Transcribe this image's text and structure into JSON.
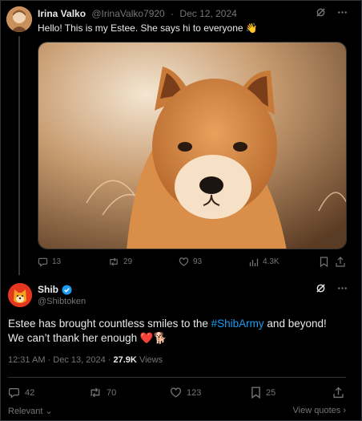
{
  "reply": {
    "display_name": "Irina Valko",
    "handle": "@IrinaValko7920",
    "separator": "·",
    "date": "Dec 12, 2024",
    "text": "Hello! This is my Estee. She says hi to everyone 👋",
    "image_alt": "Shiba Inu dog portrait",
    "stats": {
      "replies": "13",
      "reposts": "29",
      "likes": "93",
      "views": "4.3K"
    }
  },
  "main": {
    "display_name": "Shib",
    "handle": "@Shibtoken",
    "text_before": "Estee has brought countless smiles to the ",
    "hashtag": "#ShibArmy",
    "text_after": " and beyond! We can’t thank her enough ❤️🐕",
    "time": "12:31 AM",
    "separator": "·",
    "date": "Dec 13, 2024",
    "views_count": "27.9K",
    "views_label": "Views",
    "stats": {
      "replies": "42",
      "reposts": "70",
      "likes": "123",
      "bookmarks": "25"
    },
    "sort_label": "Relevant",
    "quotes_label": "View quotes"
  },
  "colors": {
    "accent": "#1d9bf0",
    "muted": "#71767b",
    "text": "#e7e9ea",
    "background": "#000000"
  }
}
